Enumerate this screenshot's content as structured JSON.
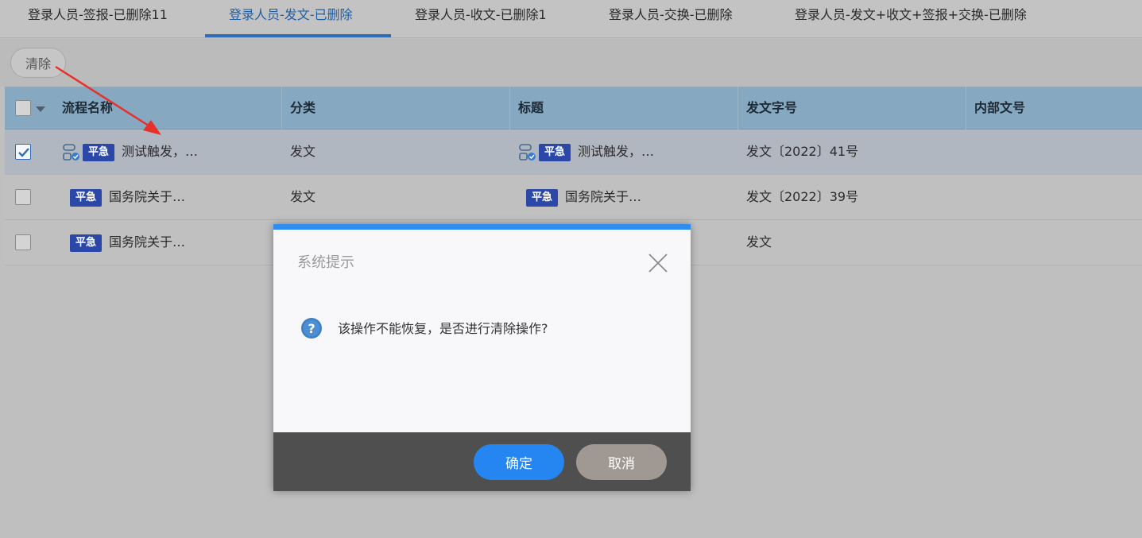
{
  "tabs": [
    {
      "label": "登录人员-签报-已删除11"
    },
    {
      "label": "登录人员-发文-已删除",
      "active": true
    },
    {
      "label": "登录人员-收文-已删除1"
    },
    {
      "label": "登录人员-交换-已删除"
    },
    {
      "label": "登录人员-发文+收文+签报+交换-已删除"
    }
  ],
  "toolbar": {
    "clear_label": "清除"
  },
  "grid": {
    "columns": [
      "流程名称",
      "分类",
      "标题",
      "发文字号",
      "内部文号"
    ],
    "rows": [
      {
        "selected": true,
        "flow_icon": true,
        "badge": "平急",
        "name": "测试触发，…",
        "category": "发文",
        "title_icon": true,
        "title_badge": "平急",
        "title": "测试触发，…",
        "doc_no": "发文〔2022〕41号",
        "internal_no": ""
      },
      {
        "selected": false,
        "flow_icon": false,
        "badge": "平急",
        "name": "国务院关于…",
        "category": "发文",
        "title_icon": false,
        "title_badge": "平急",
        "title": "国务院关于…",
        "doc_no": "发文〔2022〕39号",
        "internal_no": ""
      },
      {
        "selected": false,
        "flow_icon": false,
        "badge": "平急",
        "name": "国务院关于…",
        "category": "",
        "title_icon": false,
        "title_badge": "",
        "title": "",
        "doc_no": "发文",
        "internal_no": ""
      }
    ]
  },
  "dialog": {
    "title": "系统提示",
    "message": "该操作不能恢复，是否进行清除操作?",
    "ok_label": "确定",
    "cancel_label": "取消",
    "icon": "question-icon"
  },
  "colors": {
    "accent": "#2585f1",
    "badge": "#2b48a8",
    "header": "#86a8c1",
    "annotation": "#e8302a"
  }
}
